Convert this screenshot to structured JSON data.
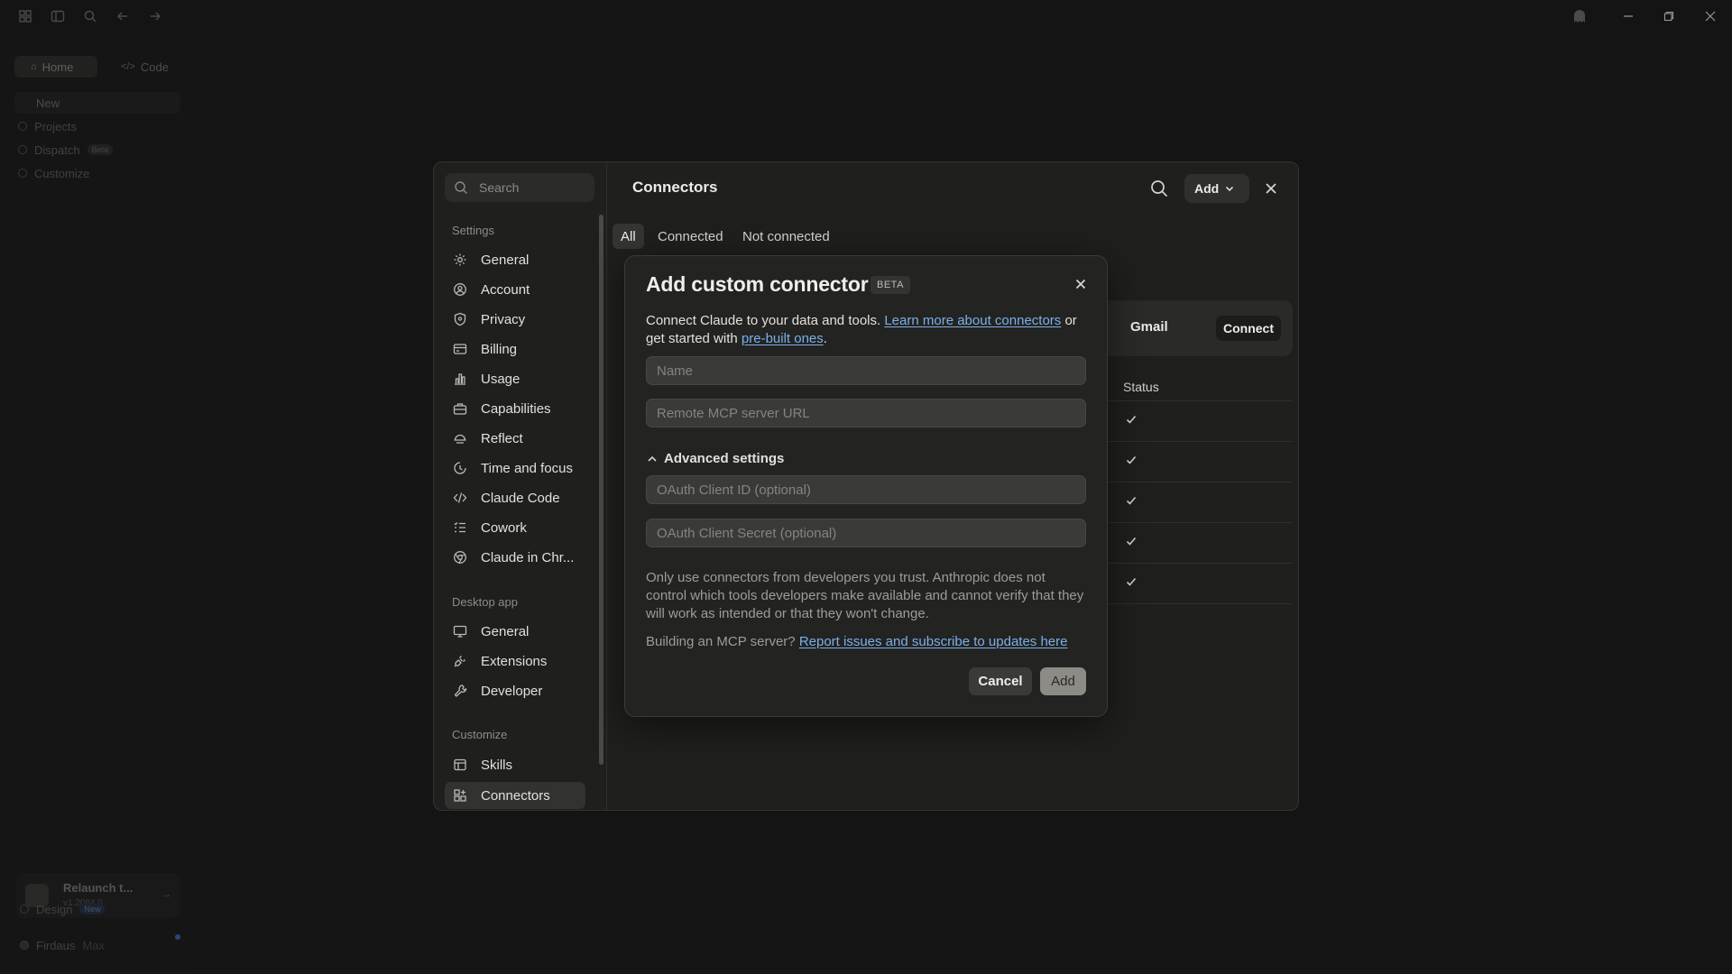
{
  "background_app": {
    "segments": {
      "home": "Home",
      "code": "Code"
    },
    "new_label": "New",
    "nav": [
      {
        "label": "Projects"
      },
      {
        "label": "Dispatch",
        "badge": "Beta"
      },
      {
        "label": "Customize"
      }
    ],
    "relaunch": {
      "title": "Relaunch t...",
      "version": "v1.2084.0"
    },
    "design": {
      "label": "Design",
      "badge": "New"
    },
    "user": {
      "name": "Firdaus",
      "plan": "Max"
    }
  },
  "settings": {
    "search_placeholder": "Search",
    "sections": {
      "settings": "Settings",
      "desktop_app": "Desktop app",
      "customize": "Customize"
    },
    "settings_items": [
      "General",
      "Account",
      "Privacy",
      "Billing",
      "Usage",
      "Capabilities",
      "Reflect",
      "Time and focus",
      "Claude Code",
      "Cowork",
      "Claude in Chr..."
    ],
    "desktop_items": [
      "General",
      "Extensions",
      "Developer"
    ],
    "customize_items": [
      "Skills",
      "Connectors"
    ],
    "active_item": "Connectors"
  },
  "connectors": {
    "title": "Connectors",
    "add_label": "Add",
    "tabs": [
      "All",
      "Connected",
      "Not connected"
    ],
    "active_tab": "All",
    "featured": {
      "name": "Gmail",
      "button": "Connect"
    },
    "status_header": "Status",
    "status_rows": 5
  },
  "dialog": {
    "title": "Add custom connector",
    "badge": "BETA",
    "desc_text": "Connect Claude to your data and tools. ",
    "desc_link": "Learn more about connectors",
    "desc_mid": " or get started with ",
    "desc_link2": "pre-built ones",
    "desc_end": ".",
    "name_placeholder": "Name",
    "url_placeholder": "Remote MCP server URL",
    "advanced_label": "Advanced settings",
    "oauth_id_placeholder": "OAuth Client ID (optional)",
    "oauth_secret_placeholder": "OAuth Client Secret (optional)",
    "warning": "Only use connectors from developers you trust. Anthropic does not control which tools developers make available and cannot verify that they will work as intended or that they won't change.",
    "mcp_text": "Building an MCP server? ",
    "mcp_link": "Report issues and subscribe to updates here",
    "cancel_label": "Cancel",
    "add_label": "Add"
  },
  "colors": {
    "link": "#7ab0e8",
    "surface": "#232322",
    "background": "#141414"
  }
}
